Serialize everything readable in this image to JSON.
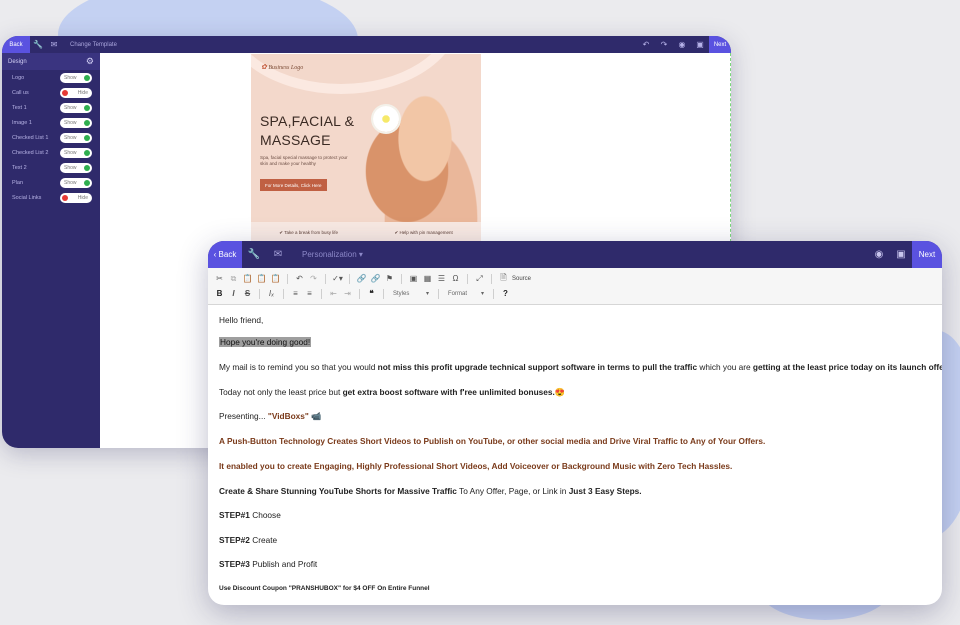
{
  "back_window": {
    "topbar": {
      "back_label": "Back",
      "template_label": "Change Template",
      "next_label": "Next"
    },
    "sidebar": {
      "title": "Design",
      "items": [
        {
          "label": "Logo",
          "state": "Show"
        },
        {
          "label": "Call us",
          "state": "Hide"
        },
        {
          "label": "Text 1",
          "state": "Show"
        },
        {
          "label": "Image 1",
          "state": "Show"
        },
        {
          "label": "Checked List 1",
          "state": "Show"
        },
        {
          "label": "Checked List 2",
          "state": "Show"
        },
        {
          "label": "Text 2",
          "state": "Show"
        },
        {
          "label": "Plan",
          "state": "Show"
        },
        {
          "label": "Social Links",
          "state": "Hide"
        }
      ]
    },
    "template": {
      "logo": "Business Logo",
      "title": "SPA,FACIAL & MASSAGE",
      "subtitle": "Spa, facial special massage to protect your skin and make your healthy",
      "button": "For More Details, Click Here",
      "check1": "Take a break from busy life",
      "check2": "Help with pin management"
    }
  },
  "front_window": {
    "topbar": {
      "back_label": "Back",
      "personalization_label": "Personalization",
      "next_label": "Next"
    },
    "toolbar": {
      "source_label": "Source",
      "styles_label": "Styles",
      "format_label": "Format"
    },
    "email": {
      "greeting": "Hello friend,",
      "highlight": "Hope you're doing good!",
      "p1_a": "My mail is to remind you so that you would ",
      "p1_b": "not miss this profit upgrade technical support software in terms to pull the traffic",
      "p1_c": " which you are ",
      "p1_d": "getting at the least price today on its launch offer.",
      "p2_a": "Today not only the least price but ",
      "p2_b": "get extra boost software with f'ree unlimited bonuses.",
      "p2_emoji": "😍",
      "p3_a": "Presenting... ",
      "p3_b": "\"VidBoxs\"",
      "p3_emoji": "📹",
      "p4": "A Push-Button Technology Creates Short Videos to Publish on YouTube, or other social media and Drive Viral Traffic to Any of Your Offers.",
      "p5": "It enabled you to create Engaging, Highly Professional Short Videos, Add Voiceover or Background Music with Zero Tech Hassles.",
      "p6_a": "Create & Share Stunning YouTube Shorts for Massive Traffic",
      "p6_b": " To Any Offer, Page, or Link in ",
      "p6_c": "Just 3 Easy Steps.",
      "step1_a": "STEP#1",
      "step1_b": " Choose",
      "step2_a": "STEP#2",
      "step2_b": " Create",
      "step3_a": "STEP#3",
      "step3_b": " Publish and Profit",
      "coupon": "Use Discount Coupon \"PRANSHUBOX\" for $4 OFF On Entire Funnel"
    }
  },
  "colors": {
    "navy": "#2f2a6b",
    "accent": "#5a52e0",
    "brown_text": "#7a3a1a",
    "spa_bg": "#f3d8cb"
  }
}
